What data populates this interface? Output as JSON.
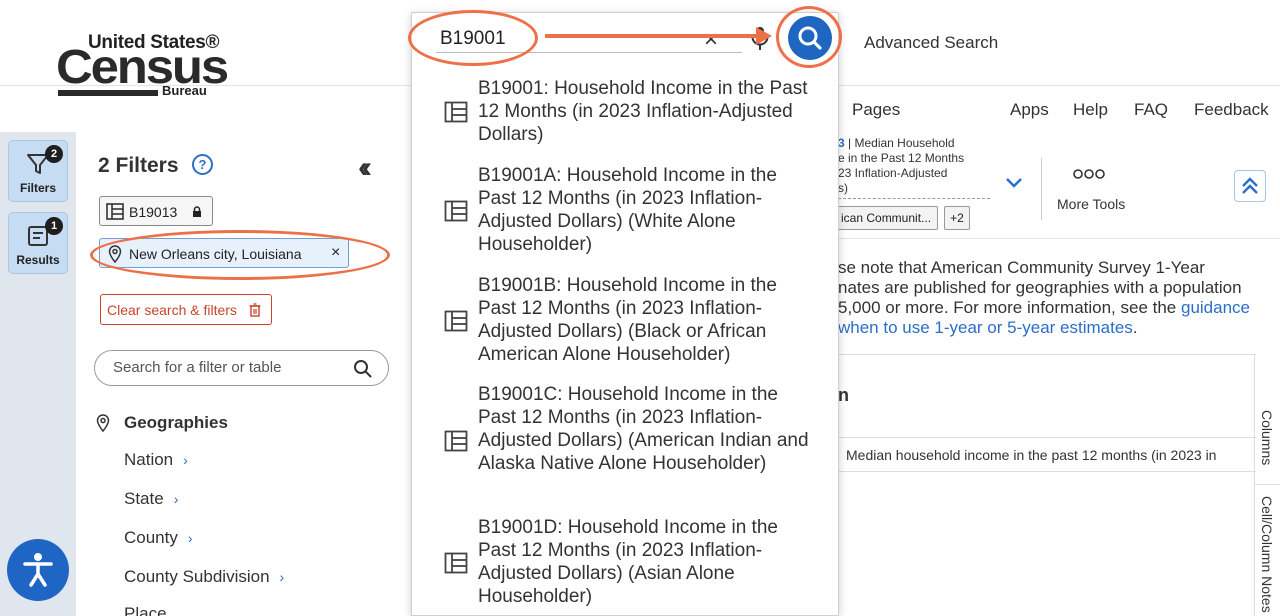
{
  "header": {
    "logo": {
      "line1": "United States®",
      "line2": "Census",
      "line3": "Bureau"
    },
    "search_value": "B19001",
    "advanced_search": "Advanced Search",
    "nav": [
      "Pages",
      "Apps",
      "Help",
      "FAQ",
      "Feedback"
    ]
  },
  "rail": {
    "filters": {
      "label": "Filters",
      "count": "2"
    },
    "results": {
      "label": "Results",
      "count": "1"
    }
  },
  "panel": {
    "title": "2 Filters",
    "help": "?",
    "chips": [
      {
        "label": "B19013"
      },
      {
        "label": "New Orleans city, Louisiana",
        "close": "×"
      }
    ],
    "clear_label": "Clear search & filters",
    "search_placeholder": "Search for a filter or table",
    "geographies_label": "Geographies",
    "geographies": [
      "Nation",
      "State",
      "County",
      "County Subdivision",
      "Place"
    ]
  },
  "dropdown": [
    {
      "text": "B19001: Household Income in the Past 12 Months (in 2023 Inflation-Adjusted Dollars)"
    },
    {
      "text": "B19001A: Household Income in the Past 12 Months (in 2023 Inflation-Adjusted Dollars) (White Alone Householder)"
    },
    {
      "text": "B19001B: Household Income in the Past 12 Months (in 2023 Inflation-Adjusted Dollars) (Black or African American Alone Householder)"
    },
    {
      "text": "B19001C: Household Income in the Past 12 Months (in 2023 Inflation-Adjusted Dollars) (American Indian and Alaska Native Alone Householder)"
    },
    {
      "text": "B19001D: Household Income in the Past 12 Months (in 2023 Inflation-Adjusted Dollars) (Asian Alone Householder)"
    }
  ],
  "content": {
    "table_info_l1_code": "3",
    "table_info_l1": " | Median Household",
    "table_info_l2": "e in the Past 12 Months",
    "table_info_l3": "23 Inflation-Adjusted",
    "table_info_l4": "s)",
    "tag1": "ican Communit...",
    "tag2": "+2",
    "more_tools": "More Tools",
    "note_l1": "se note that American Community Survey 1-Year",
    "note_l2": "nates are published for geographies with a population",
    "note_l3_a": "5,000 or more. For more information, see the ",
    "note_link1": "guidance",
    "note_link2": "when to use 1-year or 5-year estimates",
    "note_l4_end": ".",
    "grid_head": "n",
    "grid_row": "Median household income in the past 12 months (in 2023 in",
    "side_tabs": [
      "Columns",
      "Cell/Column Notes"
    ]
  },
  "colors": {
    "accent": "#1e66c0",
    "annotation": "#ee7049",
    "clear": "#c8442c"
  }
}
